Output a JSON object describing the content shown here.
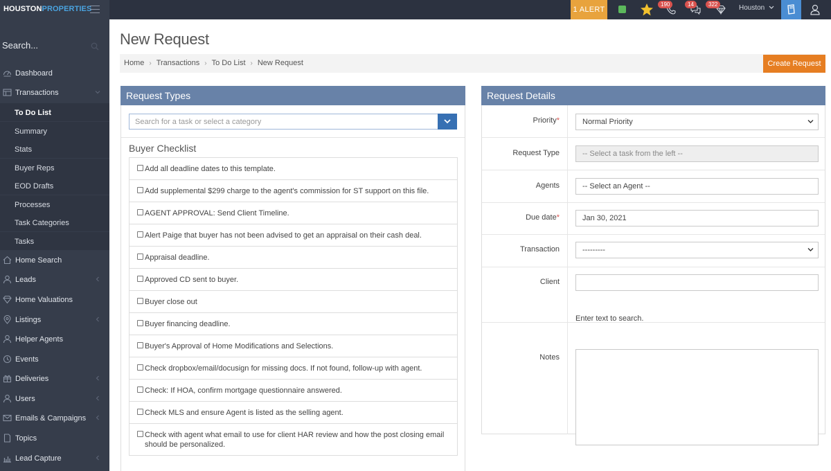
{
  "topbar": {
    "brand_part1": "HOUSTON",
    "brand_part2": "PROPERTIES",
    "alert_label": "1 ALERT",
    "phone_badge": "190",
    "chat_badge": "14",
    "diamond_badge": "322",
    "city": "Houston"
  },
  "sidebar": {
    "search_placeholder": "Search...",
    "items": [
      {
        "label": "Dashboard",
        "icon": "dashboard-icon"
      },
      {
        "label": "Transactions",
        "icon": "transactions-icon",
        "expanded": true
      },
      {
        "label": "Home Search",
        "icon": "home-search-icon"
      },
      {
        "label": "Leads",
        "icon": "leads-icon"
      },
      {
        "label": "Home Valuations",
        "icon": "diamond-icon"
      },
      {
        "label": "Listings",
        "icon": "map-marker-icon"
      },
      {
        "label": "Helper Agents",
        "icon": "user-icon"
      },
      {
        "label": "Events",
        "icon": "clock-icon"
      },
      {
        "label": "Deliveries",
        "icon": "gift-icon"
      },
      {
        "label": "Users",
        "icon": "users-icon"
      },
      {
        "label": "Emails & Campaigns",
        "icon": "envelope-icon"
      },
      {
        "label": "Topics",
        "icon": "document-icon"
      },
      {
        "label": "Lead Capture",
        "icon": "bar-chart-icon"
      }
    ],
    "subitems": [
      "To Do List",
      "Summary",
      "Stats",
      "Buyer Reps",
      "EOD Drafts",
      "Processes",
      "Task Categories",
      "Tasks"
    ],
    "active_subitem": "To Do List"
  },
  "page": {
    "title": "New Request",
    "breadcrumb": [
      "Home",
      "Transactions",
      "To Do List",
      "New Request"
    ],
    "create_button": "Create Request"
  },
  "request_types": {
    "title": "Request Types",
    "search_placeholder": "Search for a task or select a category",
    "checklist_title": "Buyer Checklist",
    "items": [
      "Add all deadline dates to this template.",
      "Add supplemental $299 charge to the agent's commission for ST support on this file.",
      "AGENT APPROVAL: Send Client Timeline.",
      "Alert Paige that buyer has not been advised to get an appraisal on their cash deal.",
      "Appraisal deadline.",
      "Approved CD sent to buyer.",
      "Buyer close out",
      "Buyer financing deadline.",
      "Buyer's Approval of Home Modifications and Selections.",
      "Check dropbox/email/docusign for missing docs. If not found, follow-up with agent.",
      "Check: If HOA, confirm mortgage questionnaire answered.",
      "Check MLS and ensure Agent is listed as the selling agent.",
      "Check with agent what email to use for client HAR review and how the post closing email should be personalized."
    ]
  },
  "request_details": {
    "title": "Request Details",
    "priority_label": "Priority",
    "priority_value": "Normal Priority",
    "request_type_label": "Request Type",
    "request_type_value": "-- Select a task from the left --",
    "agents_label": "Agents",
    "agents_value": "-- Select an Agent --",
    "due_date_label": "Due date",
    "due_date_value": "Jan 30, 2021",
    "transaction_label": "Transaction",
    "transaction_value": "---------",
    "client_label": "Client",
    "client_help": "Enter text to search.",
    "notes_label": "Notes",
    "required_mark": "*"
  },
  "colors": {
    "topbar": "#2c3240",
    "sidebar": "#363d4b",
    "panel_header": "#6882a8",
    "alert": "#e8a33d",
    "create_button": "#e67e22",
    "accent_blue": "#3770b3"
  }
}
